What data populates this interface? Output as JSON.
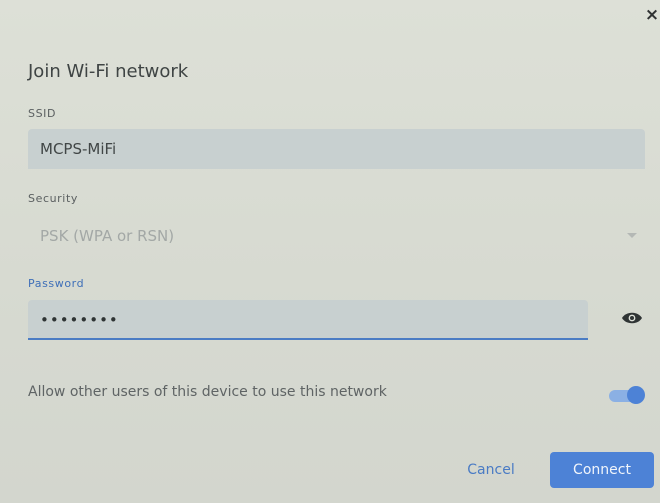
{
  "dialog": {
    "title": "Join Wi-Fi network",
    "close_symbol": "×"
  },
  "ssid": {
    "label": "SSID",
    "value": "MCPS-MiFi"
  },
  "security": {
    "label": "Security",
    "value": "PSK (WPA or RSN)"
  },
  "password": {
    "label": "Password",
    "masked_value": "••••••••",
    "visibility_icon": "eye-icon"
  },
  "share": {
    "label": "Allow other users of this device to use this network",
    "enabled": true
  },
  "buttons": {
    "cancel": "Cancel",
    "connect": "Connect"
  },
  "colors": {
    "accent": "#4d82d6",
    "field_bg": "#c8d0d0",
    "focus_underline": "#4b7cc4"
  }
}
